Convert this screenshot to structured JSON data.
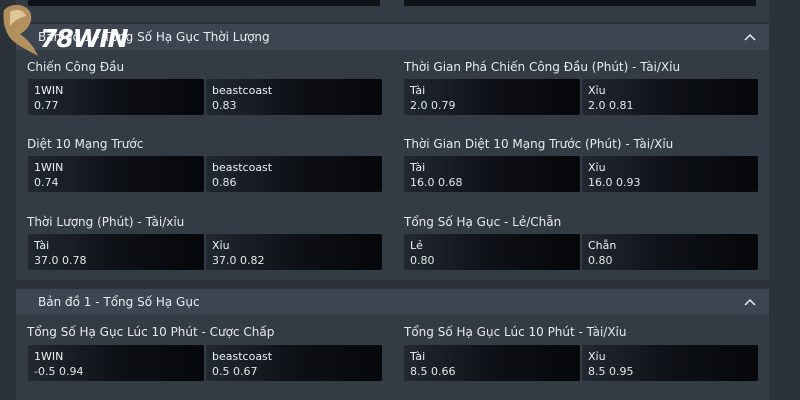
{
  "brand": {
    "logo_text": "78WIN"
  },
  "sections": [
    {
      "header": "Bản đồ 1 - Tổng Số Hạ Gục Thời Lượng",
      "markets": [
        {
          "title": "Chiến Công Đầu",
          "options": [
            {
              "label": "1WIN",
              "value": "0.77"
            },
            {
              "label": "beastcoast",
              "value": "0.83"
            }
          ]
        },
        {
          "title": "Thời Gian Phá Chiến Công Đầu (Phút) - Tài/Xỉu",
          "options": [
            {
              "label": "Tài",
              "value": "2.0 0.79"
            },
            {
              "label": "Xỉu",
              "value": "2.0 0.81"
            }
          ]
        },
        {
          "title": "Diệt 10 Mạng Trước",
          "options": [
            {
              "label": "1WIN",
              "value": "0.74"
            },
            {
              "label": "beastcoast",
              "value": "0.86"
            }
          ]
        },
        {
          "title": "Thời Gian Diệt 10 Mạng Trước (Phút) - Tài/Xỉu",
          "options": [
            {
              "label": "Tài",
              "value": "16.0 0.68"
            },
            {
              "label": "Xỉu",
              "value": "16.0 0.93"
            }
          ]
        },
        {
          "title": "Thời Lượng (Phút) - Tài/xỉu",
          "options": [
            {
              "label": "Tài",
              "value": "37.0 0.78"
            },
            {
              "label": "Xỉu",
              "value": "37.0 0.82"
            }
          ]
        },
        {
          "title": "Tổng Số Hạ Gục - Lẻ/Chẵn",
          "options": [
            {
              "label": "Lẻ",
              "value": "0.80"
            },
            {
              "label": "Chẵn",
              "value": "0.80"
            }
          ]
        }
      ]
    },
    {
      "header": "Bản đồ 1 - Tổng Số Hạ Gục",
      "markets": [
        {
          "title": "Tổng Số Hạ Gục Lúc 10 Phút - Cược Chấp",
          "options": [
            {
              "label": "1WIN",
              "value": "-0.5 0.94"
            },
            {
              "label": "beastcoast",
              "value": "0.5 0.67"
            }
          ]
        },
        {
          "title": "Tổng Số Hạ Gục Lúc 10 Phút - Tài/Xỉu",
          "options": [
            {
              "label": "Tài",
              "value": "8.5 0.66"
            },
            {
              "label": "Xỉu",
              "value": "8.5 0.95"
            }
          ]
        }
      ]
    }
  ]
}
